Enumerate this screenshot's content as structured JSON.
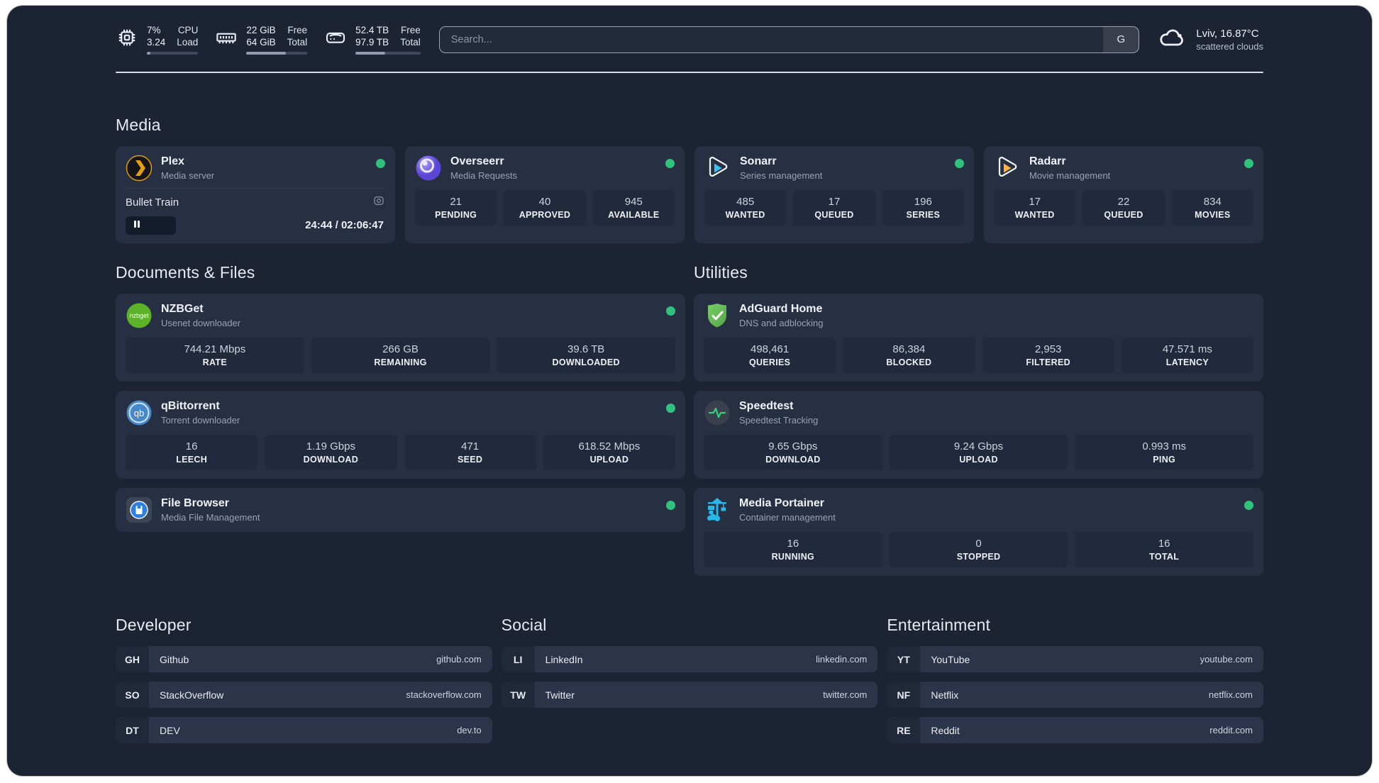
{
  "colors": {
    "status_green": "#2ec27e",
    "plex_orange": "#e5a00d",
    "sonarr_blue": "#39c2f3",
    "radarr_yellow": "#ffb53a",
    "adguard_green": "#67c257",
    "portainer_cyan": "#29b6e8",
    "nzbget_green": "#5cb32a",
    "qbittorrent_blue": "#4789c8"
  },
  "header": {
    "metrics": [
      {
        "icon": "cpu-icon",
        "value_top": "7%",
        "value_bottom": "3.24",
        "label_top": "CPU",
        "label_bottom": "Load",
        "progress_pct": 7
      },
      {
        "icon": "ram-icon",
        "value_top": "22 GiB",
        "value_bottom": "64 GiB",
        "label_top": "Free",
        "label_bottom": "Total",
        "progress_pct": 65
      },
      {
        "icon": "disk-icon",
        "value_top": "52.4 TB",
        "value_bottom": "97.9 TB",
        "label_top": "Free",
        "label_bottom": "Total",
        "progress_pct": 46
      }
    ],
    "search": {
      "placeholder": "Search...",
      "engine_label": "G"
    },
    "weather": {
      "location_temp": "Lviv, 16.87°C",
      "condition": "scattered clouds"
    }
  },
  "sections": {
    "media": {
      "title": "Media",
      "plex": {
        "name": "Plex",
        "desc": "Media server",
        "now_playing": {
          "title": "Bullet Train",
          "time_text": "24:44 / 02:06:47",
          "progress_pct": 19.5
        }
      },
      "overseerr": {
        "name": "Overseerr",
        "desc": "Media Requests",
        "stats": [
          {
            "value": "21",
            "label": "PENDING"
          },
          {
            "value": "40",
            "label": "APPROVED"
          },
          {
            "value": "945",
            "label": "AVAILABLE"
          }
        ]
      },
      "sonarr": {
        "name": "Sonarr",
        "desc": "Series management",
        "stats": [
          {
            "value": "485",
            "label": "WANTED"
          },
          {
            "value": "17",
            "label": "QUEUED"
          },
          {
            "value": "196",
            "label": "SERIES"
          }
        ]
      },
      "radarr": {
        "name": "Radarr",
        "desc": "Movie management",
        "stats": [
          {
            "value": "17",
            "label": "WANTED"
          },
          {
            "value": "22",
            "label": "QUEUED"
          },
          {
            "value": "834",
            "label": "MOVIES"
          }
        ]
      }
    },
    "documents": {
      "title": "Documents & Files",
      "nzbget": {
        "name": "NZBGet",
        "desc": "Usenet downloader",
        "stats": [
          {
            "value": "744.21 Mbps",
            "label": "RATE"
          },
          {
            "value": "266 GB",
            "label": "REMAINING"
          },
          {
            "value": "39.6 TB",
            "label": "DOWNLOADED"
          }
        ]
      },
      "qbittorrent": {
        "name": "qBittorrent",
        "desc": "Torrent downloader",
        "stats": [
          {
            "value": "16",
            "label": "LEECH"
          },
          {
            "value": "1.19 Gbps",
            "label": "DOWNLOAD"
          },
          {
            "value": "471",
            "label": "SEED"
          },
          {
            "value": "618.52 Mbps",
            "label": "UPLOAD"
          }
        ]
      },
      "filebrowser": {
        "name": "File Browser",
        "desc": "Media File Management"
      }
    },
    "utilities": {
      "title": "Utilities",
      "adguard": {
        "name": "AdGuard Home",
        "desc": "DNS and adblocking",
        "stats": [
          {
            "value": "498,461",
            "label": "QUERIES"
          },
          {
            "value": "86,384",
            "label": "BLOCKED"
          },
          {
            "value": "2,953",
            "label": "FILTERED"
          },
          {
            "value": "47.571 ms",
            "label": "LATENCY"
          }
        ]
      },
      "speedtest": {
        "name": "Speedtest",
        "desc": "Speedtest Tracking",
        "stats": [
          {
            "value": "9.65 Gbps",
            "label": "DOWNLOAD"
          },
          {
            "value": "9.24 Gbps",
            "label": "UPLOAD"
          },
          {
            "value": "0.993 ms",
            "label": "PING"
          }
        ]
      },
      "portainer": {
        "name": "Media Portainer",
        "desc": "Container management",
        "stats": [
          {
            "value": "16",
            "label": "RUNNING"
          },
          {
            "value": "0",
            "label": "STOPPED"
          },
          {
            "value": "16",
            "label": "TOTAL"
          }
        ]
      }
    }
  },
  "links": {
    "developer": {
      "title": "Developer",
      "items": [
        {
          "abbr": "GH",
          "name": "Github",
          "url": "github.com"
        },
        {
          "abbr": "SO",
          "name": "StackOverflow",
          "url": "stackoverflow.com"
        },
        {
          "abbr": "DT",
          "name": "DEV",
          "url": "dev.to"
        }
      ]
    },
    "social": {
      "title": "Social",
      "items": [
        {
          "abbr": "LI",
          "name": "LinkedIn",
          "url": "linkedin.com"
        },
        {
          "abbr": "TW",
          "name": "Twitter",
          "url": "twitter.com"
        }
      ]
    },
    "entertainment": {
      "title": "Entertainment",
      "items": [
        {
          "abbr": "YT",
          "name": "YouTube",
          "url": "youtube.com"
        },
        {
          "abbr": "NF",
          "name": "Netflix",
          "url": "netflix.com"
        },
        {
          "abbr": "RE",
          "name": "Reddit",
          "url": "reddit.com"
        }
      ]
    }
  }
}
